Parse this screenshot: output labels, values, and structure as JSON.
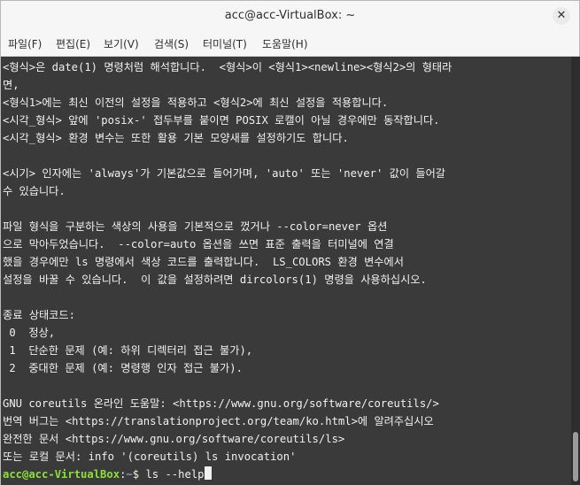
{
  "window": {
    "title": "acc@acc-VirtualBox: ~",
    "close_glyph": "✕"
  },
  "menu": [
    {
      "label": "파일(F)"
    },
    {
      "label": "편집(E)"
    },
    {
      "label": "보기(V)"
    },
    {
      "label": "검색(S)"
    },
    {
      "label": "터미널(T)"
    },
    {
      "label": "도움말(H)"
    }
  ],
  "terminal": {
    "lines": [
      "<형식>은 date(1) 명령처럼 해석합니다.  <형식>이 <형식1><newline><형식2>의 형태라",
      "면,",
      "<형식1>에는 최신 이전의 설정을 적용하고 <형식2>에 최신 설정을 적용합니다.",
      "<시각_형식> 앞에 'posix-' 접두부를 붙이면 POSIX 로캘이 아닐 경우에만 동작합니다.",
      "<시각_형식> 환경 변수는 또한 활용 기본 모양새를 설정하기도 합니다.",
      "",
      "<시기> 인자에는 'always'가 기본값으로 들어가며, 'auto' 또는 'never' 값이 들어갈",
      "수 있습니다.",
      "",
      "파일 형식을 구분하는 색상의 사용을 기본적으로 껐거나 --color=never 옵션",
      "으로 막아두었습니다.  --color=auto 옵션을 쓰면 표준 출력을 터미널에 연결",
      "했을 경우에만 ls 명령에서 색상 코드를 출력합니다.  LS_COLORS 환경 변수에서",
      "설정을 바꿀 수 있습니다.  이 값을 설정하려면 dircolors(1) 명령을 사용하십시오.",
      "",
      "종료 상태코드:",
      " 0  정상,",
      " 1  단순한 문제 (예: 하위 디렉터리 접근 불가),",
      " 2  중대한 문제 (예: 명령행 인자 접근 불가).",
      "",
      "GNU coreutils 온라인 도움말: <https://www.gnu.org/software/coreutils/>",
      "번역 버그는 <https://translationproject.org/team/ko.html>에 알려주십시오",
      "완전한 문서 <https://www.gnu.org/software/coreutils/ls>",
      "또는 로컬 문서: info '(coreutils) ls invocation'"
    ],
    "prompt": {
      "user_host": "acc@acc-VirtualBox",
      "separator": ":",
      "path": "~",
      "symbol": "$ ",
      "command": "ls --help"
    }
  },
  "colors": {
    "terminal_bg": "#3a3a3a",
    "terminal_fg": "#f0f0f0",
    "prompt_user": "#8ae234",
    "prompt_path": "#729fcf"
  }
}
